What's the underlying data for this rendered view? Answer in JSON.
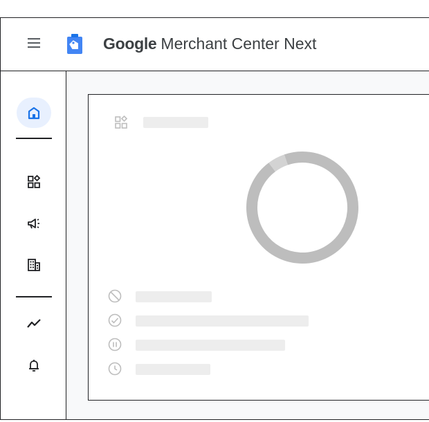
{
  "header": {
    "brand": "Google",
    "product": "Merchant Center Next"
  },
  "icons": {
    "menu": "hamburger-menu-icon",
    "logo": "merchant-center-logo-icon",
    "rail": [
      "home-icon",
      "products-icon",
      "marketing-icon",
      "business-icon",
      "performance-icon",
      "notifications-icon"
    ],
    "card_header": "products-icon",
    "statuses": [
      "disapproved-icon",
      "approved-icon",
      "paused-icon",
      "pending-icon"
    ]
  },
  "colors": {
    "accent_blue": "#1a73e8",
    "active_bg": "#e8f0fe",
    "placeholder": "#ededed",
    "donut_dark": "#bdbdbd",
    "donut_light": "#d3d3d3"
  },
  "chart_data": {
    "type": "pie",
    "donut": true,
    "values": [
      0.95,
      0.05
    ],
    "loading": true
  }
}
